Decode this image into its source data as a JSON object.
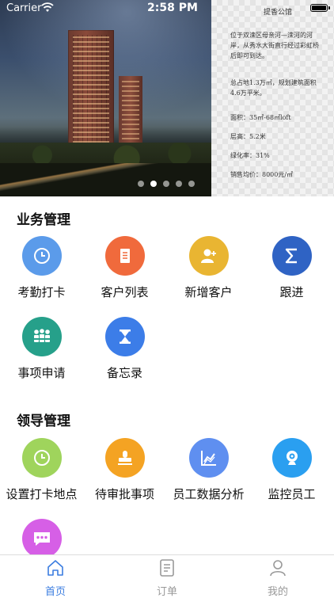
{
  "status_bar": {
    "carrier": "Carrier",
    "time": "2:58 PM"
  },
  "banner": {
    "info_title": "提香公馆",
    "info_paragraphs": [
      "位于双滦区母亲河—滦河的河岸，从秀水大街直行经过彩虹桥后即可到达。",
      "总占地1.3万㎡，规划建筑面积4.6万平米。",
      "面积：35㎡-68㎡loft",
      "层高：5.2米",
      "绿化率：31%",
      "销售均价：8000元/㎡"
    ],
    "page_count": 5,
    "active_page": 1
  },
  "business": {
    "title": "业务管理",
    "items": [
      {
        "label": "考勤打卡",
        "icon": "clock-icon",
        "color": "#5b9bea"
      },
      {
        "label": "客户列表",
        "icon": "document-icon",
        "color": "#f06a3c"
      },
      {
        "label": "新增客户",
        "icon": "add-user-icon",
        "color": "#e9b532"
      },
      {
        "label": "跟进",
        "icon": "sigma-icon",
        "color": "#2f63c4"
      },
      {
        "label": "事项申请",
        "icon": "meeting-icon",
        "color": "#26a08a"
      },
      {
        "label": "备忘录",
        "icon": "hourglass-icon",
        "color": "#3c7de8"
      }
    ]
  },
  "leader": {
    "title": "领导管理",
    "items": [
      {
        "label": "设置打卡地点",
        "icon": "clock-icon",
        "color": "#9fd45c"
      },
      {
        "label": "待审批事项",
        "icon": "stamp-icon",
        "color": "#f4a323"
      },
      {
        "label": "员工数据分析",
        "icon": "chart-icon",
        "color": "#5f8ff0"
      },
      {
        "label": "监控员工",
        "icon": "camera-icon",
        "color": "#2a9ff0"
      },
      {
        "label": "",
        "icon": "chat-icon",
        "color": "#d65fe6"
      }
    ]
  },
  "tabbar": {
    "items": [
      {
        "label": "首页",
        "icon": "home-icon",
        "active": true
      },
      {
        "label": "订单",
        "icon": "order-icon",
        "active": false
      },
      {
        "label": "我的",
        "icon": "profile-icon",
        "active": false
      }
    ],
    "active_color": "#3b7de0",
    "inactive_color": "#999999"
  }
}
